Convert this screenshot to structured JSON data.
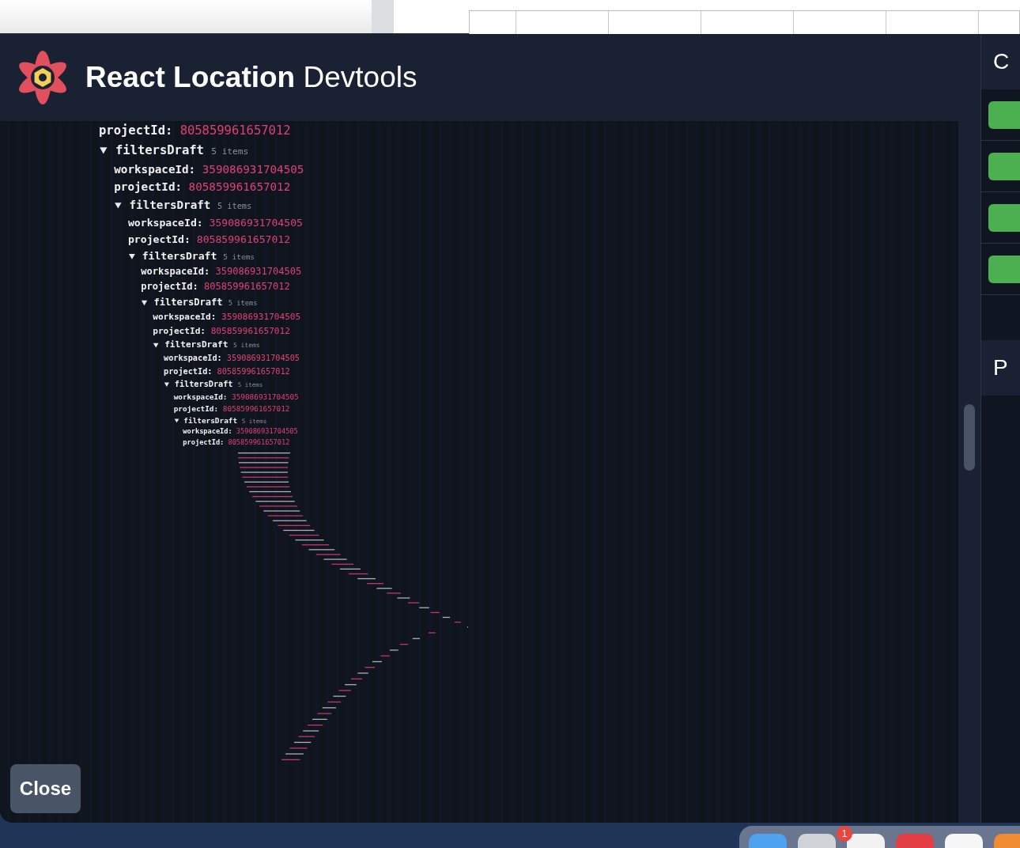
{
  "header": {
    "title_strong": "React Location",
    "title_light": "Devtools"
  },
  "tree": {
    "children": [
      {
        "kind": "value",
        "key": "projectId:",
        "value": "805859961657012"
      },
      {
        "kind": "object",
        "key": "filtersDraft",
        "count": "5 items",
        "expanded": true,
        "children": [
          {
            "kind": "value",
            "key": "workspaceId:",
            "value": "359086931704505"
          },
          {
            "kind": "value",
            "key": "projectId:",
            "value": "805859961657012"
          },
          {
            "kind": "object",
            "key": "filtersDraft",
            "count": "5 items",
            "expanded": true,
            "children": [
              {
                "kind": "value",
                "key": "workspaceId:",
                "value": "359086931704505"
              },
              {
                "kind": "value",
                "key": "projectId:",
                "value": "805859961657012"
              },
              {
                "kind": "object",
                "key": "filtersDraft",
                "count": "5 items",
                "expanded": true,
                "children": [
                  {
                    "kind": "value",
                    "key": "workspaceId:",
                    "value": "359086931704505"
                  },
                  {
                    "kind": "value",
                    "key": "projectId:",
                    "value": "805859961657012"
                  },
                  {
                    "kind": "object",
                    "key": "filtersDraft",
                    "count": "5 items",
                    "expanded": true,
                    "children": [
                      {
                        "kind": "value",
                        "key": "workspaceId:",
                        "value": "359086931704505"
                      },
                      {
                        "kind": "value",
                        "key": "projectId:",
                        "value": "805859961657012"
                      },
                      {
                        "kind": "object",
                        "key": "filtersDraft",
                        "count": "5 items",
                        "expanded": true,
                        "children": [
                          {
                            "kind": "value",
                            "key": "workspaceId:",
                            "value": "359086931704505"
                          },
                          {
                            "kind": "value",
                            "key": "projectId:",
                            "value": "805859961657012"
                          },
                          {
                            "kind": "object",
                            "key": "filtersDraft",
                            "count": "5 items",
                            "expanded": true,
                            "children": [
                              {
                                "kind": "value",
                                "key": "workspaceId:",
                                "value": "359086931704505"
                              },
                              {
                                "kind": "value",
                                "key": "projectId:",
                                "value": "805859961657012"
                              },
                              {
                                "kind": "object",
                                "key": "filtersDraft",
                                "count": "5 items",
                                "expanded": true,
                                "children": [
                                  {
                                    "kind": "value",
                                    "key": "workspaceId:",
                                    "value": "359086931704505"
                                  },
                                  {
                                    "kind": "value",
                                    "key": "projectId:",
                                    "value": "805859961657012"
                                  }
                                ]
                              }
                            ]
                          }
                        ]
                      }
                    ]
                  }
                ]
              }
            ]
          }
        ]
      }
    ]
  },
  "close_button": "Close",
  "side_panel": {
    "heading": "C",
    "rows": [
      {
        "kind": "button"
      },
      {
        "kind": "button"
      },
      {
        "kind": "button"
      },
      {
        "kind": "button"
      }
    ],
    "footer": "P"
  },
  "dock": {
    "badge": "1"
  }
}
